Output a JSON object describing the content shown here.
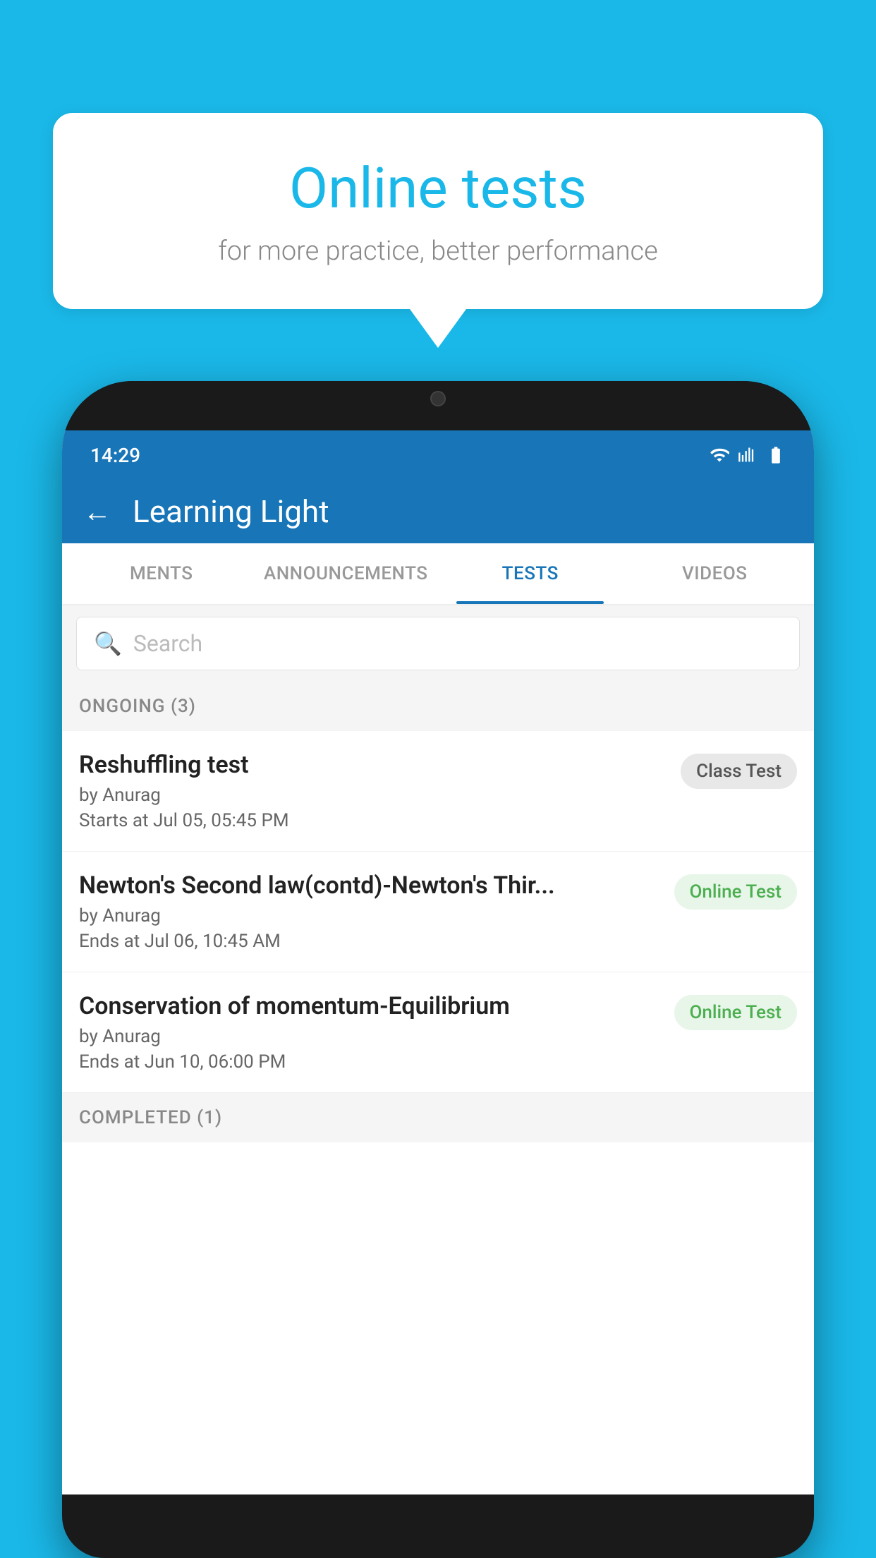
{
  "background_color": "#1ab8e8",
  "bubble": {
    "title": "Online tests",
    "subtitle": "for more practice, better performance"
  },
  "phone": {
    "status_bar": {
      "time": "14:29",
      "icons": [
        "wifi",
        "signal",
        "battery"
      ]
    },
    "header": {
      "title": "Learning Light",
      "back_label": "←"
    },
    "tabs": [
      {
        "label": "MENTS",
        "active": false
      },
      {
        "label": "ANNOUNCEMENTS",
        "active": false
      },
      {
        "label": "TESTS",
        "active": true
      },
      {
        "label": "VIDEOS",
        "active": false
      }
    ],
    "search": {
      "placeholder": "Search"
    },
    "ongoing_section": {
      "label": "ONGOING (3)"
    },
    "test_items": [
      {
        "name": "Reshuffling test",
        "by": "by Anurag",
        "time": "Starts at  Jul 05, 05:45 PM",
        "badge": "Class Test",
        "badge_type": "class"
      },
      {
        "name": "Newton's Second law(contd)-Newton's Thir...",
        "by": "by Anurag",
        "time": "Ends at  Jul 06, 10:45 AM",
        "badge": "Online Test",
        "badge_type": "online"
      },
      {
        "name": "Conservation of momentum-Equilibrium",
        "by": "by Anurag",
        "time": "Ends at  Jun 10, 06:00 PM",
        "badge": "Online Test",
        "badge_type": "online"
      }
    ],
    "completed_section": {
      "label": "COMPLETED (1)"
    }
  }
}
